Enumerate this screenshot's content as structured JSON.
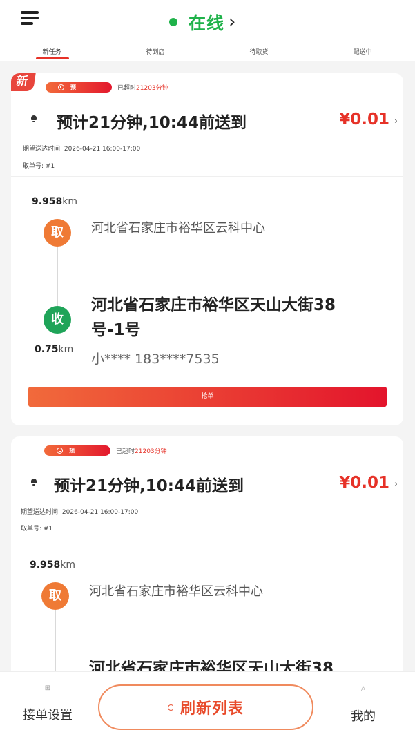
{
  "header": {
    "status": "在线",
    "status_color": "#1fb24a"
  },
  "tabs": [
    {
      "label": "新任务",
      "active": true
    },
    {
      "label": "待到店",
      "active": false
    },
    {
      "label": "待取货",
      "active": false
    },
    {
      "label": "配送中",
      "active": false
    }
  ],
  "orders": [
    {
      "new_badge": "新",
      "tag": "预",
      "overtime_prefix": "已超时",
      "overtime_value": "21203分钟",
      "eta": "预计21分钟,10:44前送到",
      "price": "¥0.01",
      "expected_time": "期望送达时间: 2026-04-21 16:00-17:00",
      "pickup_no": "取单号: #1",
      "pickup_distance": "9.958",
      "pickup_unit": "km",
      "pickup_label": "取",
      "pickup_address": "河北省石家庄市裕华区云科中心",
      "delivery_label": "收",
      "delivery_address_line1": "河北省石家庄市裕华区天山大街38",
      "delivery_address_line2": "号-1号",
      "delivery_distance": "0.75",
      "delivery_unit": "km",
      "contact": "小**** 183****7535",
      "grab_label": "抢单"
    },
    {
      "tag": "预",
      "overtime_prefix": "已超时",
      "overtime_value": "21203分钟",
      "eta": "预计21分钟,10:44前送到",
      "price": "¥0.01",
      "expected_time": "期望送达时间: 2026-04-21 16:00-17:00",
      "pickup_no": "取单号: #1",
      "pickup_distance": "9.958",
      "pickup_unit": "km",
      "pickup_label": "取",
      "pickup_address": "河北省石家庄市裕华区云科中心",
      "delivery_address_line1": "河北省石家庄市裕华区天山大街38"
    }
  ],
  "bottom_nav": {
    "settings_label": "接单设置",
    "refresh_label": "刷新列表",
    "mine_label": "我的"
  },
  "colors": {
    "accent": "#e63228",
    "pickup": "#ef7a35",
    "delivery": "#1fa459"
  }
}
